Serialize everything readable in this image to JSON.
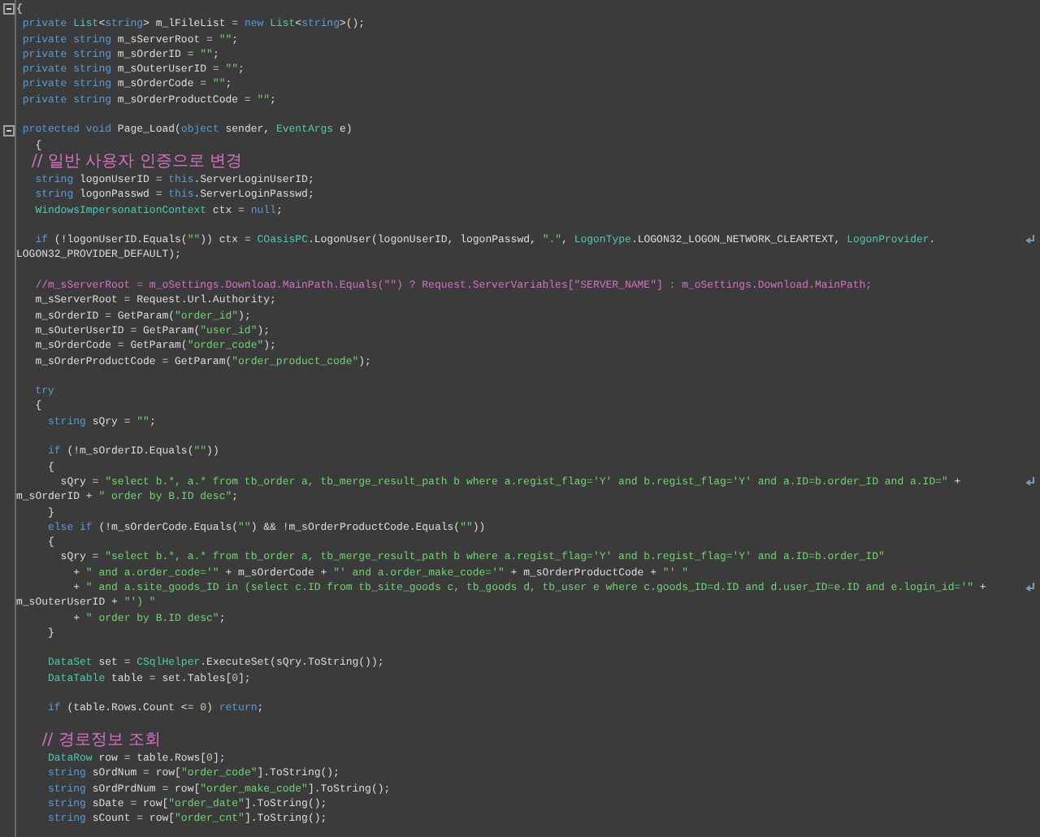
{
  "editor": {
    "lines": [
      {
        "kind": "code",
        "expanded": true,
        "tokens": [
          {
            "kind": "text",
            "text": "{"
          }
        ]
      },
      {
        "kind": "code",
        "tokens": [
          {
            "kind": "keyword",
            "text": " private "
          },
          {
            "kind": "type",
            "text": "List"
          },
          {
            "kind": "text",
            "text": "<"
          },
          {
            "kind": "keyword",
            "text": "string"
          },
          {
            "kind": "text",
            "text": "> m_lFileList = "
          },
          {
            "kind": "keyword",
            "text": "new "
          },
          {
            "kind": "type",
            "text": "List"
          },
          {
            "kind": "text",
            "text": "<"
          },
          {
            "kind": "keyword",
            "text": "string"
          },
          {
            "kind": "text",
            "text": ">();"
          }
        ]
      },
      {
        "kind": "code",
        "tokens": [
          {
            "kind": "keyword",
            "text": " private string"
          },
          {
            "kind": "text",
            "text": " m_sServerRoot = "
          },
          {
            "kind": "string",
            "text": "\"\""
          },
          {
            "kind": "text",
            "text": ";"
          }
        ]
      },
      {
        "kind": "code",
        "tokens": [
          {
            "kind": "keyword",
            "text": " private string"
          },
          {
            "kind": "text",
            "text": " m_sOrderID = "
          },
          {
            "kind": "string",
            "text": "\"\""
          },
          {
            "kind": "text",
            "text": ";"
          }
        ]
      },
      {
        "kind": "code",
        "tokens": [
          {
            "kind": "keyword",
            "text": " private string"
          },
          {
            "kind": "text",
            "text": " m_sOuterUserID = "
          },
          {
            "kind": "string",
            "text": "\"\""
          },
          {
            "kind": "text",
            "text": ";"
          }
        ]
      },
      {
        "kind": "code",
        "tokens": [
          {
            "kind": "keyword",
            "text": " private string"
          },
          {
            "kind": "text",
            "text": " m_sOrderCode = "
          },
          {
            "kind": "string",
            "text": "\"\""
          },
          {
            "kind": "text",
            "text": ";"
          }
        ]
      },
      {
        "kind": "code",
        "tokens": [
          {
            "kind": "keyword",
            "text": " private string"
          },
          {
            "kind": "text",
            "text": " m_sOrderProductCode = "
          },
          {
            "kind": "string",
            "text": "\"\""
          },
          {
            "kind": "text",
            "text": ";"
          }
        ]
      },
      {
        "kind": "blank"
      },
      {
        "kind": "code",
        "expanded": true,
        "tokens": [
          {
            "kind": "keyword",
            "text": " protected void"
          },
          {
            "kind": "text",
            "text": " Page_Load("
          },
          {
            "kind": "keyword",
            "text": "object"
          },
          {
            "kind": "text",
            "text": " sender, "
          },
          {
            "kind": "type",
            "text": "EventArgs"
          },
          {
            "kind": "text",
            "text": " e)"
          }
        ]
      },
      {
        "kind": "code",
        "tokens": [
          {
            "kind": "text",
            "text": "   {"
          }
        ]
      },
      {
        "kind": "remark",
        "tokens": [
          {
            "kind": "comment",
            "text": "   // 일반 사용자 인증으로 변경"
          }
        ]
      },
      {
        "kind": "code",
        "tokens": [
          {
            "kind": "keyword",
            "text": "   string"
          },
          {
            "kind": "text",
            "text": " logonUserID = "
          },
          {
            "kind": "keyword",
            "text": "this"
          },
          {
            "kind": "text",
            "text": ".ServerLoginUserID;"
          }
        ]
      },
      {
        "kind": "code",
        "tokens": [
          {
            "kind": "keyword",
            "text": "   string"
          },
          {
            "kind": "text",
            "text": " logonPasswd = "
          },
          {
            "kind": "keyword",
            "text": "this"
          },
          {
            "kind": "text",
            "text": ".ServerLoginPasswd;"
          }
        ]
      },
      {
        "kind": "code",
        "tokens": [
          {
            "kind": "type",
            "text": "   WindowsImpersonationContext"
          },
          {
            "kind": "text",
            "text": " ctx = "
          },
          {
            "kind": "keyword",
            "text": "null"
          },
          {
            "kind": "text",
            "text": ";"
          }
        ]
      },
      {
        "kind": "blank"
      },
      {
        "kind": "code",
        "wrapped": true,
        "tokens": [
          {
            "kind": "keyword",
            "text": "   if"
          },
          {
            "kind": "text",
            "text": " (!logonUserID.Equals("
          },
          {
            "kind": "string",
            "text": "\"\""
          },
          {
            "kind": "text",
            "text": ")) ctx = "
          },
          {
            "kind": "type",
            "text": "COasisPC"
          },
          {
            "kind": "text",
            "text": ".LogonUser(logonUserID, logonPasswd, "
          },
          {
            "kind": "string",
            "text": "\".\""
          },
          {
            "kind": "text",
            "text": ", "
          },
          {
            "kind": "type",
            "text": "LogonType"
          },
          {
            "kind": "text",
            "text": ".LOGON32_LOGON_NETWORK_CLEARTEXT, "
          },
          {
            "kind": "type",
            "text": "LogonProvider"
          },
          {
            "kind": "text",
            "text": "."
          }
        ]
      },
      {
        "kind": "code",
        "tokens": [
          {
            "kind": "text",
            "text": "LOGON32_PROVIDER_DEFAULT);"
          }
        ]
      },
      {
        "kind": "blank"
      },
      {
        "kind": "code",
        "tokens": [
          {
            "kind": "comment",
            "text": "   //m_sServerRoot = m_oSettings.Download.MainPath.Equals(\"\") ? Request.ServerVariables[\"SERVER_NAME\"] : m_oSettings.Download.MainPath;"
          }
        ]
      },
      {
        "kind": "code",
        "tokens": [
          {
            "kind": "text",
            "text": "   m_sServerRoot = Request.Url.Authority;"
          }
        ]
      },
      {
        "kind": "code",
        "tokens": [
          {
            "kind": "text",
            "text": "   m_sOrderID = GetParam("
          },
          {
            "kind": "string",
            "text": "\"order_id\""
          },
          {
            "kind": "text",
            "text": ");"
          }
        ]
      },
      {
        "kind": "code",
        "tokens": [
          {
            "kind": "text",
            "text": "   m_sOuterUserID = GetParam("
          },
          {
            "kind": "string",
            "text": "\"user_id\""
          },
          {
            "kind": "text",
            "text": ");"
          }
        ]
      },
      {
        "kind": "code",
        "tokens": [
          {
            "kind": "text",
            "text": "   m_sOrderCode = GetParam("
          },
          {
            "kind": "string",
            "text": "\"order_code\""
          },
          {
            "kind": "text",
            "text": ");"
          }
        ]
      },
      {
        "kind": "code",
        "tokens": [
          {
            "kind": "text",
            "text": "   m_sOrderProductCode = GetParam("
          },
          {
            "kind": "string",
            "text": "\"order_product_code\""
          },
          {
            "kind": "text",
            "text": ");"
          }
        ]
      },
      {
        "kind": "blank"
      },
      {
        "kind": "code",
        "tokens": [
          {
            "kind": "keyword",
            "text": "   try"
          }
        ]
      },
      {
        "kind": "code",
        "tokens": [
          {
            "kind": "text",
            "text": "   {"
          }
        ]
      },
      {
        "kind": "code",
        "tokens": [
          {
            "kind": "keyword",
            "text": "     string"
          },
          {
            "kind": "text",
            "text": " sQry = "
          },
          {
            "kind": "string",
            "text": "\"\""
          },
          {
            "kind": "text",
            "text": ";"
          }
        ]
      },
      {
        "kind": "blank"
      },
      {
        "kind": "code",
        "tokens": [
          {
            "kind": "keyword",
            "text": "     if"
          },
          {
            "kind": "text",
            "text": " (!m_sOrderID.Equals("
          },
          {
            "kind": "string",
            "text": "\"\""
          },
          {
            "kind": "text",
            "text": "))"
          }
        ]
      },
      {
        "kind": "code",
        "tokens": [
          {
            "kind": "text",
            "text": "     {"
          }
        ]
      },
      {
        "kind": "code",
        "wrapped": true,
        "tokens": [
          {
            "kind": "text",
            "text": "       sQry = "
          },
          {
            "kind": "string",
            "text": "\"select b.*, a.* from tb_order a, tb_merge_result_path b where a.regist_flag='Y' and b.regist_flag='Y' and a.ID=b.order_ID and a.ID=\""
          },
          {
            "kind": "text",
            "text": " +"
          }
        ]
      },
      {
        "kind": "code",
        "tokens": [
          {
            "kind": "text",
            "text": "m_sOrderID + "
          },
          {
            "kind": "string",
            "text": "\" order by B.ID desc\""
          },
          {
            "kind": "text",
            "text": ";"
          }
        ]
      },
      {
        "kind": "code",
        "tokens": [
          {
            "kind": "text",
            "text": "     }"
          }
        ]
      },
      {
        "kind": "code",
        "tokens": [
          {
            "kind": "keyword",
            "text": "     else if"
          },
          {
            "kind": "text",
            "text": " (!m_sOrderCode.Equals("
          },
          {
            "kind": "string",
            "text": "\"\""
          },
          {
            "kind": "text",
            "text": ") && !m_sOrderProductCode.Equals("
          },
          {
            "kind": "string",
            "text": "\"\""
          },
          {
            "kind": "text",
            "text": "))"
          }
        ]
      },
      {
        "kind": "code",
        "tokens": [
          {
            "kind": "text",
            "text": "     {"
          }
        ]
      },
      {
        "kind": "code",
        "tokens": [
          {
            "kind": "text",
            "text": "       sQry = "
          },
          {
            "kind": "string",
            "text": "\"select b.*, a.* from tb_order a, tb_merge_result_path b where a.regist_flag='Y' and b.regist_flag='Y' and a.ID=b.order_ID\""
          }
        ]
      },
      {
        "kind": "code",
        "tokens": [
          {
            "kind": "text",
            "text": "         + "
          },
          {
            "kind": "string",
            "text": "\" and a.order_code='\""
          },
          {
            "kind": "text",
            "text": " + m_sOrderCode + "
          },
          {
            "kind": "string",
            "text": "\"' and a.order_make_code='\""
          },
          {
            "kind": "text",
            "text": " + m_sOrderProductCode + "
          },
          {
            "kind": "string",
            "text": "\"' \""
          }
        ]
      },
      {
        "kind": "code",
        "wrapped": true,
        "tokens": [
          {
            "kind": "text",
            "text": "         + "
          },
          {
            "kind": "string",
            "text": "\" and a.site_goods_ID in (select c.ID from tb_site_goods c, tb_goods d, tb_user e where c.goods_ID=d.ID and d.user_ID=e.ID and e.login_id='\""
          },
          {
            "kind": "text",
            "text": " +"
          }
        ]
      },
      {
        "kind": "code",
        "tokens": [
          {
            "kind": "text",
            "text": "m_sOuterUserID + "
          },
          {
            "kind": "string",
            "text": "\"') \""
          }
        ]
      },
      {
        "kind": "code",
        "tokens": [
          {
            "kind": "text",
            "text": "         + "
          },
          {
            "kind": "string",
            "text": "\" order by B.ID desc\""
          },
          {
            "kind": "text",
            "text": ";"
          }
        ]
      },
      {
        "kind": "code",
        "tokens": [
          {
            "kind": "text",
            "text": "     }"
          }
        ]
      },
      {
        "kind": "blank"
      },
      {
        "kind": "code",
        "tokens": [
          {
            "kind": "type",
            "text": "     DataSet"
          },
          {
            "kind": "text",
            "text": " set = "
          },
          {
            "kind": "type",
            "text": "CSqlHelper"
          },
          {
            "kind": "text",
            "text": ".ExecuteSet(sQry.ToString());"
          }
        ]
      },
      {
        "kind": "code",
        "tokens": [
          {
            "kind": "type",
            "text": "     DataTable"
          },
          {
            "kind": "text",
            "text": " table = set.Tables["
          },
          {
            "kind": "number",
            "text": "0"
          },
          {
            "kind": "text",
            "text": "];"
          }
        ]
      },
      {
        "kind": "blank"
      },
      {
        "kind": "code",
        "tokens": [
          {
            "kind": "keyword",
            "text": "     if"
          },
          {
            "kind": "text",
            "text": " (table.Rows.Count <= "
          },
          {
            "kind": "number",
            "text": "0"
          },
          {
            "kind": "text",
            "text": ") "
          },
          {
            "kind": "keyword",
            "text": "return"
          },
          {
            "kind": "text",
            "text": ";"
          }
        ]
      },
      {
        "kind": "blank"
      },
      {
        "kind": "remark",
        "tokens": [
          {
            "kind": "comment",
            "text": "     // 경로정보 조회"
          }
        ]
      },
      {
        "kind": "code",
        "tokens": [
          {
            "kind": "type",
            "text": "     DataRow"
          },
          {
            "kind": "text",
            "text": " row = table.Rows["
          },
          {
            "kind": "number",
            "text": "0"
          },
          {
            "kind": "text",
            "text": "];"
          }
        ]
      },
      {
        "kind": "code",
        "tokens": [
          {
            "kind": "keyword",
            "text": "     string"
          },
          {
            "kind": "text",
            "text": " sOrdNum = row["
          },
          {
            "kind": "string",
            "text": "\"order_code\""
          },
          {
            "kind": "text",
            "text": "].ToString();"
          }
        ]
      },
      {
        "kind": "code",
        "tokens": [
          {
            "kind": "keyword",
            "text": "     string"
          },
          {
            "kind": "text",
            "text": " sOrdPrdNum = row["
          },
          {
            "kind": "string",
            "text": "\"order_make_code\""
          },
          {
            "kind": "text",
            "text": "].ToString();"
          }
        ]
      },
      {
        "kind": "code",
        "tokens": [
          {
            "kind": "keyword",
            "text": "     string"
          },
          {
            "kind": "text",
            "text": " sDate = row["
          },
          {
            "kind": "string",
            "text": "\"order_date\""
          },
          {
            "kind": "text",
            "text": "].ToString();"
          }
        ]
      },
      {
        "kind": "code",
        "tokens": [
          {
            "kind": "keyword",
            "text": "     string"
          },
          {
            "kind": "text",
            "text": " sCount = row["
          },
          {
            "kind": "string",
            "text": "\"order_cnt\""
          },
          {
            "kind": "text",
            "text": "].ToString();"
          }
        ]
      }
    ]
  }
}
